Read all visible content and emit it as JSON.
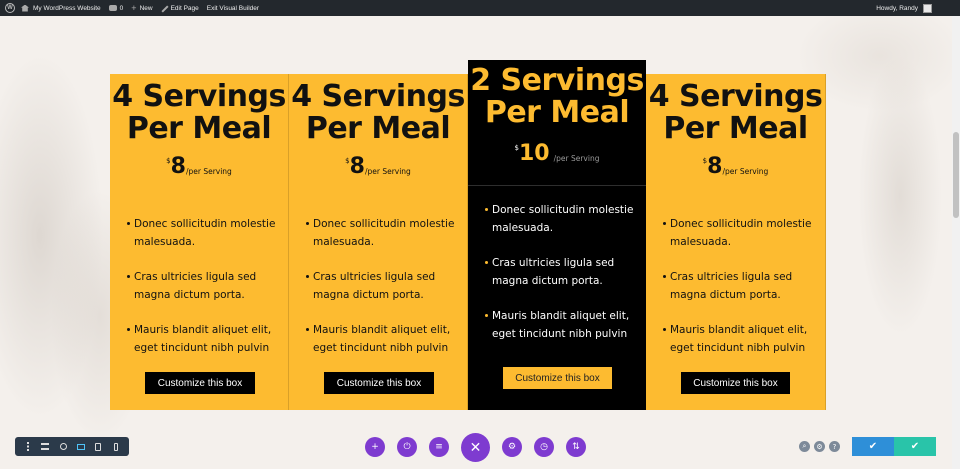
{
  "admin_bar": {
    "site_name": "My WordPress Website",
    "comments_count": "0",
    "new_label": "New",
    "edit_page_label": "Edit Page",
    "exit_builder_label": "Exit Visual Builder",
    "greeting": "Howdy, Randy"
  },
  "pricing": {
    "cards": [
      {
        "title_line1": "4 Servings",
        "title_line2": "Per Meal",
        "currency": "$",
        "price": "8",
        "per": "/per Serving",
        "features": [
          "Donec sollicitudin molestie malesuada.",
          "Cras ultricies ligula sed magna dictum porta.",
          "Mauris blandit aliquet elit, eget tincidunt nibh pulvin"
        ],
        "button": "Customize this box"
      },
      {
        "title_line1": "4 Servings",
        "title_line2": "Per Meal",
        "currency": "$",
        "price": "8",
        "per": "/per Serving",
        "features": [
          "Donec sollicitudin molestie malesuada.",
          "Cras ultricies ligula sed magna dictum porta.",
          "Mauris blandit aliquet elit, eget tincidunt nibh pulvin"
        ],
        "button": "Customize this box"
      },
      {
        "title_line1": "2 Servings",
        "title_line2": "Per Meal",
        "currency": "$",
        "price": "10",
        "per": "/per Serving",
        "features": [
          "Donec sollicitudin molestie malesuada.",
          "Cras ultricies ligula sed magna dictum porta.",
          "Mauris blandit aliquet elit, eget tincidunt nibh pulvin"
        ],
        "button": "Customize this box"
      },
      {
        "title_line1": "4 Servings",
        "title_line2": "Per Meal",
        "currency": "$",
        "price": "8",
        "per": "/per Serving",
        "features": [
          "Donec sollicitudin molestie malesuada.",
          "Cras ultricies ligula sed magna dictum porta.",
          "Mauris blandit aliquet elit, eget tincidunt nibh pulvin"
        ],
        "button": "Customize this box"
      }
    ]
  },
  "builder_controls": {
    "page_icons": [
      "add-icon",
      "power-icon",
      "layers-icon",
      "close-icon",
      "settings-icon",
      "history-icon",
      "portability-icon"
    ],
    "help_icons": [
      "search-icon",
      "settings-icon",
      "help-icon"
    ]
  },
  "colors": {
    "accent": "#fdbb30",
    "featured_bg": "#000000",
    "builder_purple": "#7e3bd0",
    "save_blue": "#2e8fd8",
    "publish_green": "#29c4a9"
  }
}
